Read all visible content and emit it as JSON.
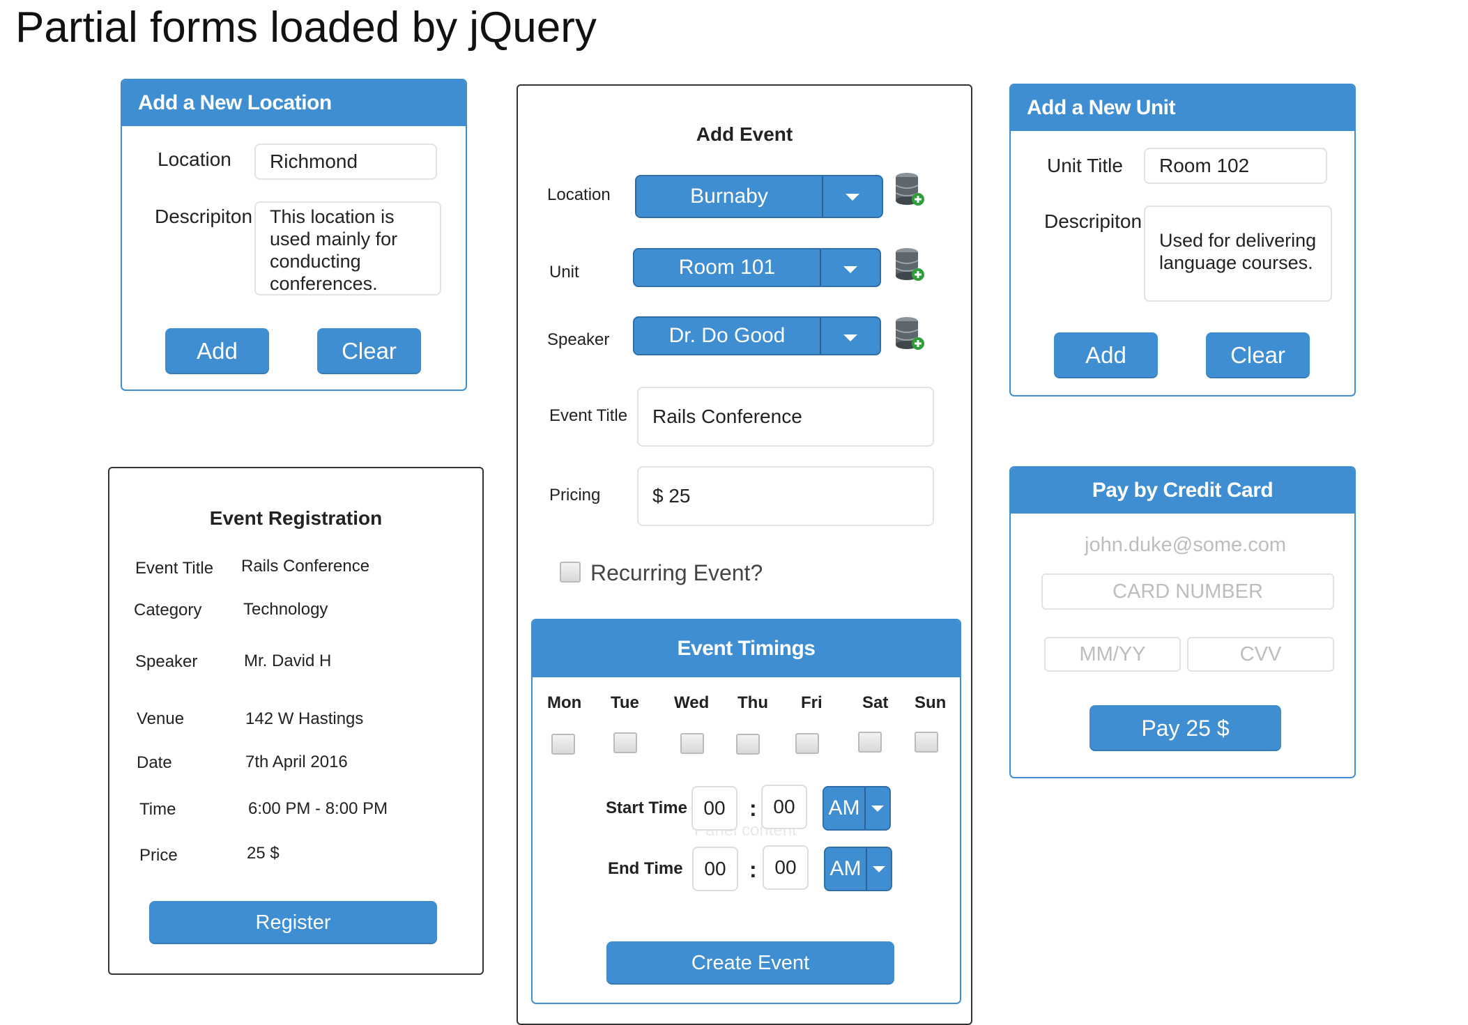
{
  "page_title": "Partial forms loaded by jQuery",
  "colors": {
    "accent": "#3f8ed1",
    "accent_dark": "#2f6ea8",
    "border_dark": "#333333"
  },
  "location_form": {
    "header": "Add a New Location",
    "location_label": "Location",
    "location_value": "Richmond",
    "description_label": "Descripiton",
    "description_value": "This location is\nused mainly for\nconducting\nconferences.",
    "add_button": "Add",
    "clear_button": "Clear"
  },
  "registration": {
    "title": "Event Registration",
    "rows": [
      {
        "label": "Event Title",
        "value": "Rails Conference"
      },
      {
        "label": "Category",
        "value": "Technology"
      },
      {
        "label": "Speaker",
        "value": "Mr. David H"
      },
      {
        "label": "Venue",
        "value": "142 W Hastings"
      },
      {
        "label": "Date",
        "value": "7th April 2016"
      },
      {
        "label": "Time",
        "value": "6:00 PM - 8:00 PM"
      },
      {
        "label": "Price",
        "value": "25 $"
      }
    ],
    "register_button": "Register"
  },
  "event_form": {
    "title": "Add Event",
    "location_label": "Location",
    "location_value": "Burnaby",
    "unit_label": "Unit",
    "unit_value": "Room 101",
    "speaker_label": "Speaker",
    "speaker_value": "Dr. Do Good",
    "add_icon": "database-add-icon",
    "event_title_label": "Event Title",
    "event_title_value": "Rails Conference",
    "pricing_label": "Pricing",
    "pricing_value": "$ 25",
    "recurring_label": "Recurring Event?",
    "recurring_checked": false,
    "timings": {
      "header": "Event Timings",
      "days": [
        "Mon",
        "Tue",
        "Wed",
        "Thu",
        "Fri",
        "Sat",
        "Sun"
      ],
      "start_label": "Start Time",
      "start_hour": "00",
      "start_minute": "00",
      "start_ampm": "AM",
      "end_label": "End Time",
      "end_hour": "00",
      "end_minute": "00",
      "end_ampm": "AM",
      "colon": ":",
      "watermark": "Panel content"
    },
    "create_button": "Create Event"
  },
  "unit_form": {
    "header": "Add a New Unit",
    "title_label": "Unit Title",
    "title_value": "Room 102",
    "description_label": "Descripiton",
    "description_value": "Used for delivering\nlanguage courses.",
    "add_button": "Add",
    "clear_button": "Clear"
  },
  "payment": {
    "header": "Pay by Credit Card",
    "email_placeholder": "john.duke@some.com",
    "card_placeholder": "CARD NUMBER",
    "expiry_placeholder": "MM/YY",
    "cvv_placeholder": "CVV",
    "pay_button": "Pay 25 $"
  }
}
